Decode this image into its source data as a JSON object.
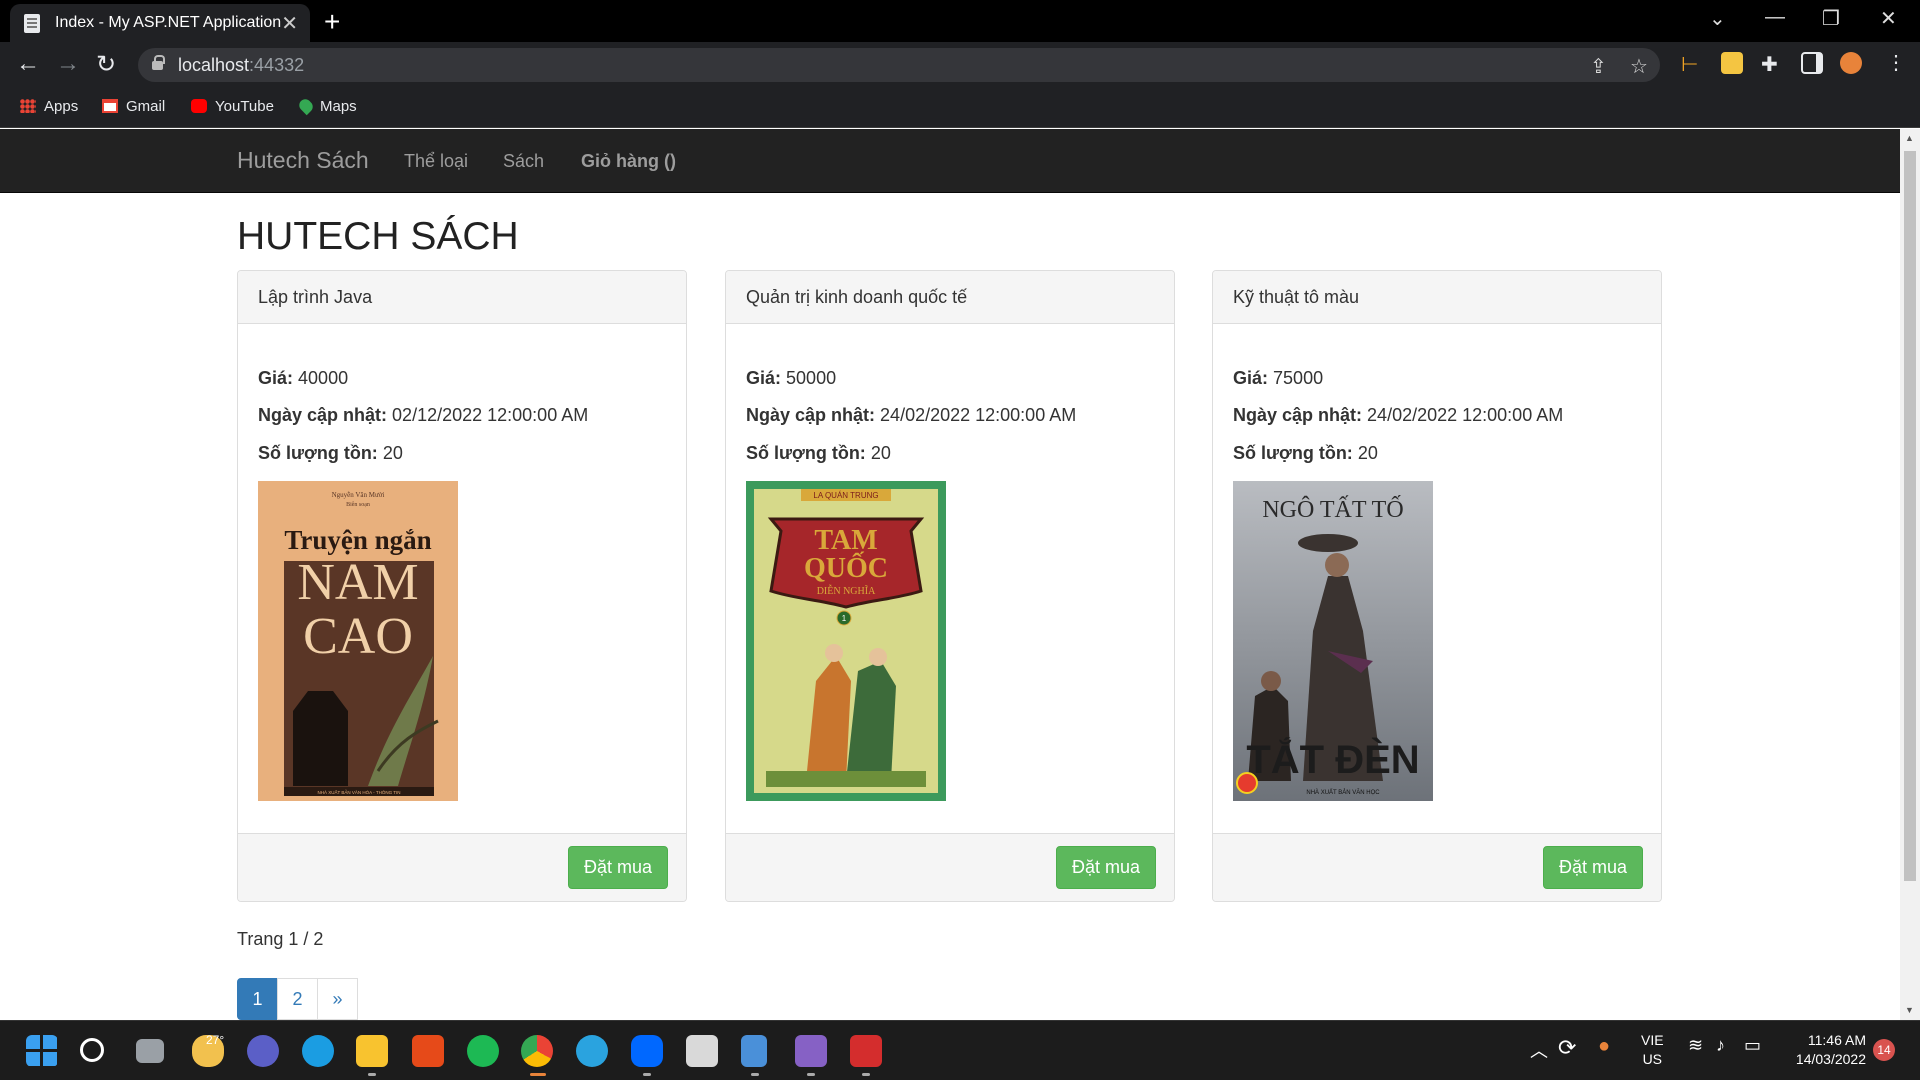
{
  "browser": {
    "tab_title": "Index - My ASP.NET Application",
    "url_host": "localhost",
    "url_port": ":44332",
    "bookmarks": [
      "Apps",
      "Gmail",
      "YouTube",
      "Maps"
    ]
  },
  "site": {
    "brand": "Hutech Sách",
    "nav": [
      "Thể loại",
      "Sách",
      "Giỏ hàng ()"
    ]
  },
  "page": {
    "title": "HUTECH SÁCH",
    "labels": {
      "price": "Giá:",
      "updated": "Ngày cập nhật:",
      "stock": "Số lượng tồn:"
    },
    "buy_label": "Đặt mua",
    "books": [
      {
        "title": "Lập trình Java",
        "price": "40000",
        "updated": "02/12/2022 12:00:00 AM",
        "stock": "20",
        "cover": {
          "small_top": "Nguyễn Văn Mười",
          "small_sub": "Biên soạn",
          "line1": "Truyện ngắn",
          "line2": "NAM",
          "line3": "CAO",
          "publisher": "NHÀ XUẤT BẢN VĂN HÓA - THÔNG TIN",
          "colors": {
            "bg": "#e8b07d",
            "panel": "#5a3626",
            "text": "#f1d0a8"
          }
        }
      },
      {
        "title": "Quản trị kinh doanh quốc tế",
        "price": "50000",
        "updated": "24/02/2022 12:00:00 AM",
        "stock": "20",
        "cover": {
          "author": "LA QUÁN TRUNG",
          "line1": "TAM",
          "line2": "QUỐC",
          "line3": "DIỄN NGHĨA",
          "volume": "1",
          "colors": {
            "bg": "#3c9a5c",
            "banner": "#a6262a",
            "text": "#d9a83a"
          }
        }
      },
      {
        "title": "Kỹ thuật tô màu",
        "price": "75000",
        "updated": "24/02/2022 12:00:00 AM",
        "stock": "20",
        "cover": {
          "author": "NGÔ TẤT TỐ",
          "title": "TẮT ĐÈN",
          "publisher": "NHÀ XUẤT BẢN VĂN HỌC",
          "colors": {
            "bg": "#8a8f96",
            "figure": "#3a3330",
            "text": "#1c1c1c"
          }
        }
      }
    ],
    "page_info": "Trang 1 / 2",
    "pager": [
      "1",
      "2",
      "»"
    ]
  },
  "taskbar": {
    "weather": "27°",
    "lang_top": "VIE",
    "lang_bottom": "US",
    "time": "11:46 AM",
    "date": "14/03/2022",
    "notifications": "14"
  },
  "colors": {
    "navbar": "#222222",
    "brand_text": "#9d9d9d",
    "button_success": "#5cb85c",
    "pager_active": "#337ab7"
  }
}
